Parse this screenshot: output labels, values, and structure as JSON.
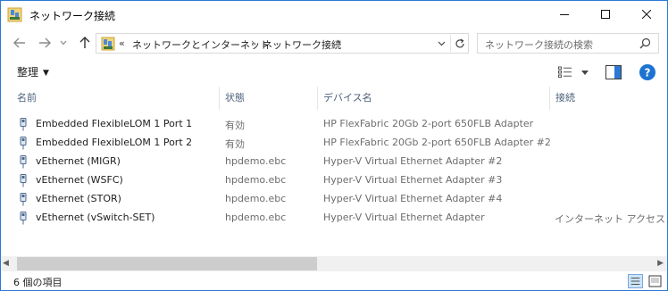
{
  "window": {
    "title": "ネットワーク接続",
    "app_icon": "network-connections-icon",
    "controls": [
      "minimize-icon",
      "maximize-icon",
      "close-icon"
    ]
  },
  "navigation": {
    "back_icon": "arrow-left-icon",
    "forward_icon": "arrow-right-icon",
    "recent_icon": "chevron-down-icon",
    "up_icon": "arrow-up-icon",
    "address": {
      "overflow": "«",
      "breadcrumbs": [
        "ネットワークとインターネット",
        "ネットワーク接続"
      ],
      "separator": "›"
    },
    "search": {
      "placeholder": "ネットワーク接続の検索"
    }
  },
  "toolbar": {
    "organize_label": "整理"
  },
  "columns": [
    "名前",
    "状態",
    "デバイス名",
    "接続"
  ],
  "connections": [
    {
      "name": "Embedded FlexibleLOM 1 Port 1",
      "status": "有効",
      "device": "HP FlexFabric 20Gb 2-port 650FLB Adapter",
      "connectivity": ""
    },
    {
      "name": "Embedded FlexibleLOM 1 Port 2",
      "status": "有効",
      "device": "HP FlexFabric 20Gb 2-port 650FLB Adapter #2",
      "connectivity": ""
    },
    {
      "name": "vEthernet (MIGR)",
      "status": "hpdemo.ebc",
      "device": "Hyper-V Virtual Ethernet Adapter #2",
      "connectivity": ""
    },
    {
      "name": "vEthernet (WSFC)",
      "status": "hpdemo.ebc",
      "device": "Hyper-V Virtual Ethernet Adapter #3",
      "connectivity": ""
    },
    {
      "name": "vEthernet (STOR)",
      "status": "hpdemo.ebc",
      "device": "Hyper-V Virtual Ethernet Adapter #4",
      "connectivity": ""
    },
    {
      "name": "vEthernet (vSwitch-SET)",
      "status": "hpdemo.ebc",
      "device": "Hyper-V Virtual Ethernet Adapter",
      "connectivity": "インターネット アクセス"
    }
  ],
  "statusbar": {
    "item_count": "6 個の項目"
  },
  "colors": {
    "accent": "#2b79d6",
    "header_text": "#4c607a",
    "secondary_text": "#6d6d6d",
    "help_icon": "#1c73d1"
  }
}
